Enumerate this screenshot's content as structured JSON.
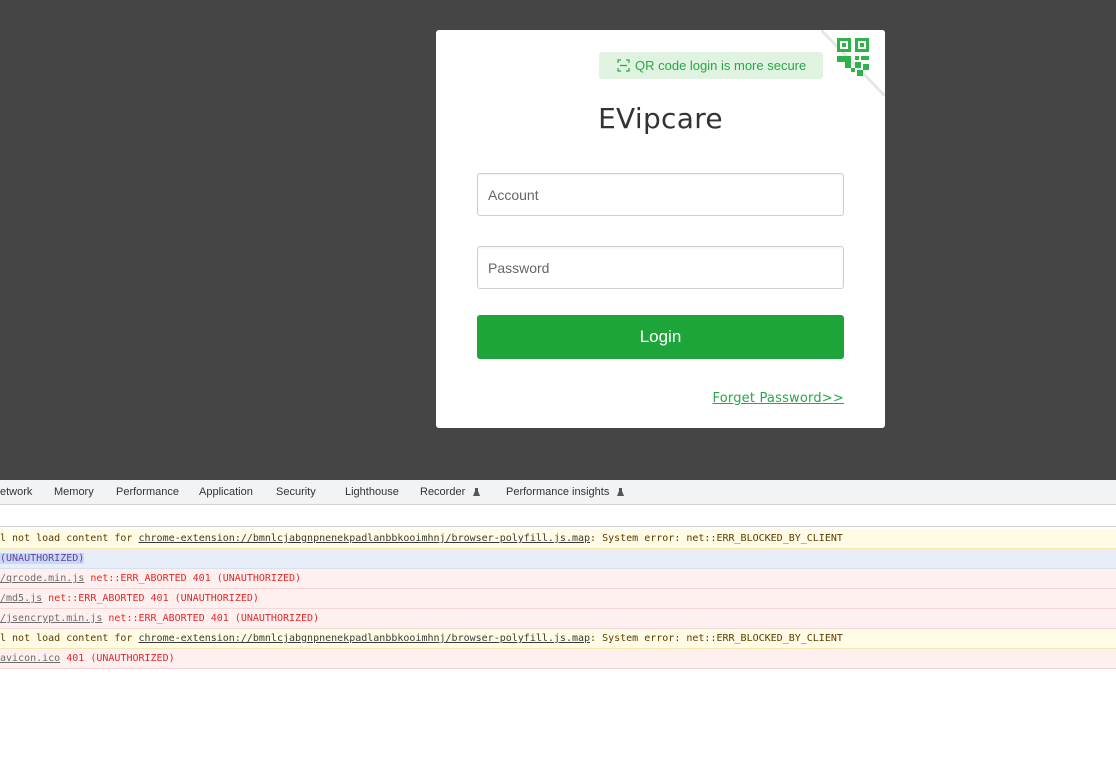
{
  "login": {
    "qr_tip": "QR code login is more secure",
    "brand": "EVipcare",
    "account_placeholder": "Account",
    "password_placeholder": "Password",
    "login_label": "Login",
    "forget_label": "Forget Password>>",
    "accent_color": "#1ea53a"
  },
  "devtools": {
    "tabs": [
      {
        "label": "etwork"
      },
      {
        "label": "Memory"
      },
      {
        "label": "Performance"
      },
      {
        "label": "Application"
      },
      {
        "label": "Security"
      },
      {
        "label": "Lighthouse"
      },
      {
        "label": "Recorder"
      },
      {
        "label": "Performance insights"
      }
    ],
    "rows": [
      {
        "prefix": "l not load content for ",
        "link": "chrome-extension://bmnlcjabgnpnenekpadlanbbkooimhnj/browser-polyfill.js.map",
        "suffix": ": System error: net::ERR_BLOCKED_BY_CLIENT"
      },
      {
        "prefix": "",
        "link": "",
        "suffix": "(UNAUTHORIZED)"
      },
      {
        "prefix": "",
        "link": "/qrcode.min.js",
        "suffix": " net::ERR_ABORTED 401 (UNAUTHORIZED)"
      },
      {
        "prefix": "",
        "link": "/md5.js",
        "suffix": " net::ERR_ABORTED 401 (UNAUTHORIZED)"
      },
      {
        "prefix": "",
        "link": "/jsencrypt.min.js",
        "suffix": " net::ERR_ABORTED 401 (UNAUTHORIZED)"
      },
      {
        "prefix": "l not load content for ",
        "link": "chrome-extension://bmnlcjabgnpnenekpadlanbbkooimhnj/browser-polyfill.js.map",
        "suffix": ": System error: net::ERR_BLOCKED_BY_CLIENT"
      },
      {
        "prefix": "",
        "link": "avicon.ico",
        "suffix": " 401 (UNAUTHORIZED)"
      }
    ]
  }
}
